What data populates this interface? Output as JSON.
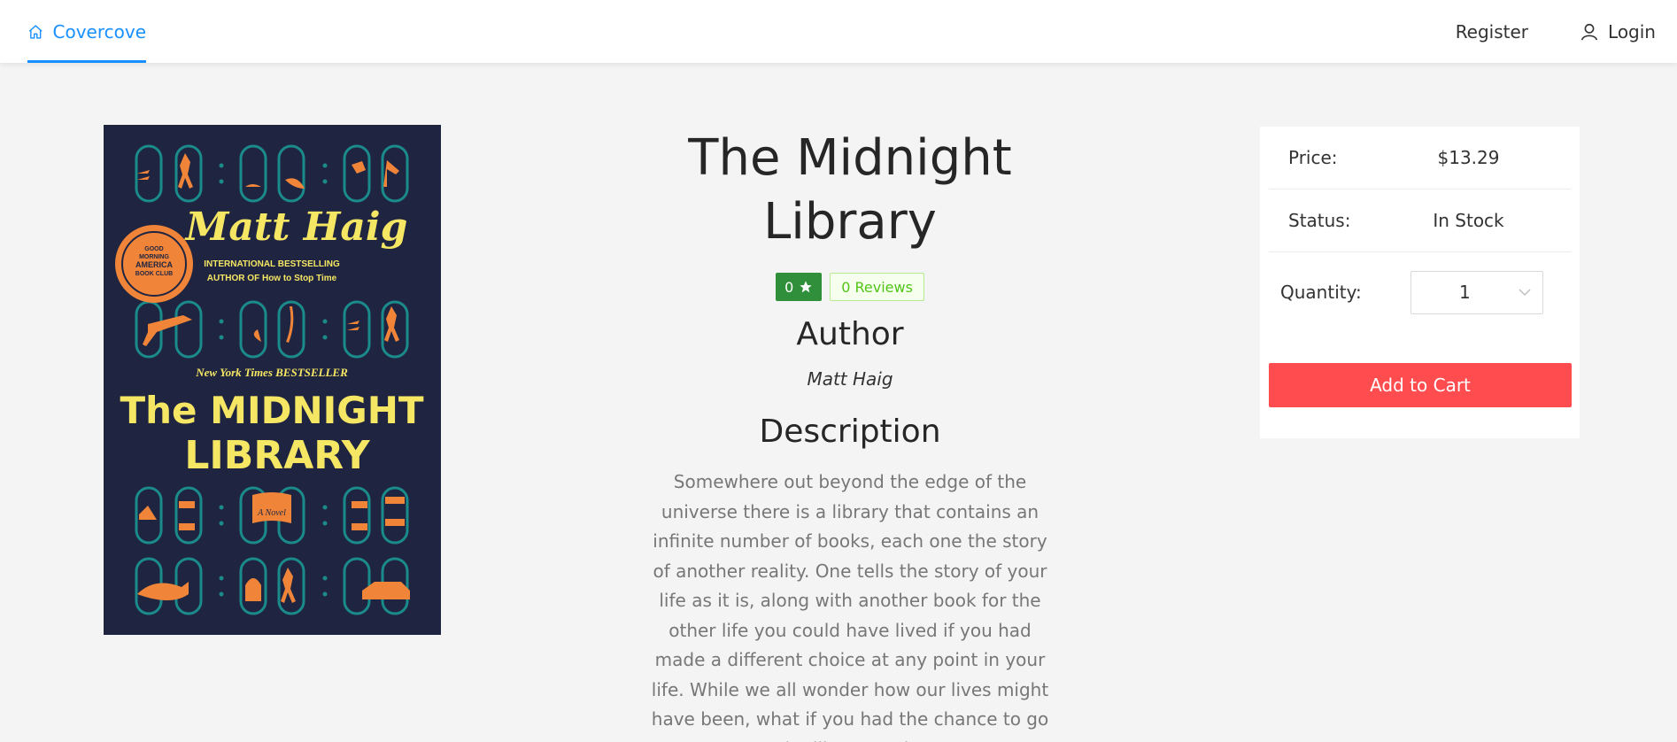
{
  "header": {
    "brand": "Covercove",
    "register": "Register",
    "login": "Login"
  },
  "book": {
    "title": "The Midnight Library",
    "rating": "0",
    "reviews": "0 Reviews",
    "author_heading": "Author",
    "author": "Matt Haig",
    "description_heading": "Description",
    "description": "Somewhere out beyond the edge of the universe there is a library that contains an infinite number of books, each one the story of another reality. One tells the story of your life as it is, along with another book for the other life you could have lived if you had made a different choice at any point in your life. While we all wonder how our lives might have been, what if you had the chance to go to the library and see"
  },
  "cover": {
    "author": "Matt Haig",
    "tagline1": "INTERNATIONAL BESTSELLING",
    "tagline2": "AUTHOR OF How to Stop Time",
    "nyt": "New York Times BESTSELLER",
    "title1": "The MIDNIGHT",
    "title2": "LIBRARY",
    "novel": "A Novel",
    "seal1": "GOOD",
    "seal2": "MORNING",
    "seal3": "AMERICA",
    "seal4": "BOOK CLUB"
  },
  "purchase": {
    "price_label": "Price:",
    "price": "$13.29",
    "status_label": "Status:",
    "status": "In Stock",
    "quantity_label": "Quantity",
    "quantity": "1",
    "add_to_cart": "Add to Cart"
  },
  "colors": {
    "primary": "#1890ff",
    "rating_badge": "#2f8f3a",
    "add_to_cart": "#ff4d4f",
    "cover_bg": "#1f2541",
    "cover_accent": "#f0853a",
    "cover_title": "#f5e663"
  }
}
